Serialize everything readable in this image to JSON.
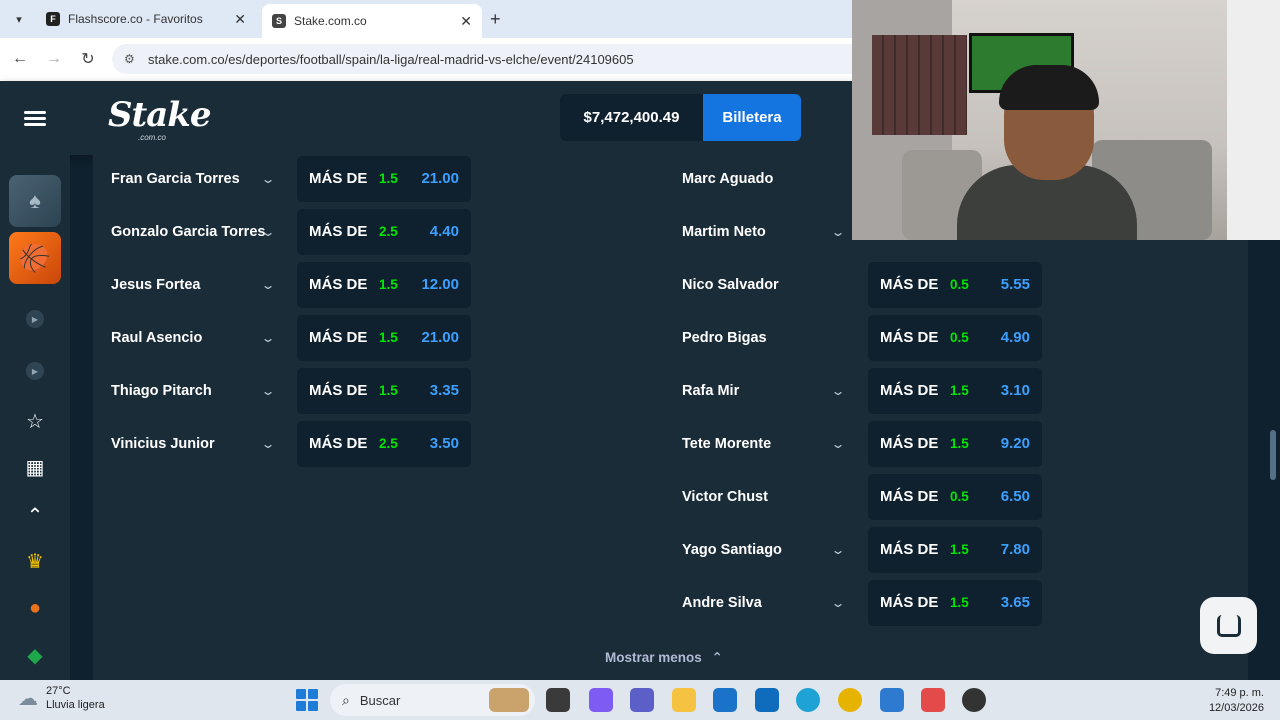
{
  "browser": {
    "tabs": [
      {
        "title": "Flashscore.co - Favoritos"
      },
      {
        "title": "Stake.com.co"
      }
    ],
    "url": "stake.com.co/es/deportes/football/spain/la-liga/real-madrid-vs-elche/event/24109605"
  },
  "header": {
    "logo": "Stake",
    "logo_sub": ".com.co",
    "balance": "$7,472,400.49",
    "wallet_label": "Billetera"
  },
  "left_column": [
    {
      "player": "Fran Garcia Torres",
      "label": "MÁS DE",
      "line": "1.5",
      "price": "21.00"
    },
    {
      "player": "Gonzalo Garcia Torres",
      "label": "MÁS DE",
      "line": "2.5",
      "price": "4.40"
    },
    {
      "player": "Jesus Fortea",
      "label": "MÁS DE",
      "line": "1.5",
      "price": "12.00"
    },
    {
      "player": "Raul Asencio",
      "label": "MÁS DE",
      "line": "1.5",
      "price": "21.00"
    },
    {
      "player": "Thiago Pitarch",
      "label": "MÁS DE",
      "line": "1.5",
      "price": "3.35"
    },
    {
      "player": "Vinicius Junior",
      "label": "MÁS DE",
      "line": "2.5",
      "price": "3.50"
    }
  ],
  "right_column": [
    {
      "player": "Marc Aguado"
    },
    {
      "player": "Martim Neto"
    },
    {
      "player": "Nico Salvador",
      "label": "MÁS DE",
      "line": "0.5",
      "price": "5.55"
    },
    {
      "player": "Pedro Bigas",
      "label": "MÁS DE",
      "line": "0.5",
      "price": "4.90"
    },
    {
      "player": "Rafa Mir",
      "label": "MÁS DE",
      "line": "1.5",
      "price": "3.10"
    },
    {
      "player": "Tete Morente",
      "label": "MÁS DE",
      "line": "1.5",
      "price": "9.20"
    },
    {
      "player": "Victor Chust",
      "label": "MÁS DE",
      "line": "0.5",
      "price": "6.50"
    },
    {
      "player": "Yago Santiago",
      "label": "MÁS DE",
      "line": "1.5",
      "price": "7.80"
    },
    {
      "player": "Andre Silva",
      "label": "MÁS DE",
      "line": "1.5",
      "price": "3.65"
    }
  ],
  "show_less": "Mostrar menos",
  "taskbar": {
    "temperature": "27°C",
    "weather": "Lluvia ligera",
    "search_placeholder": "Buscar",
    "time": "7:49 p. m.",
    "date": "12/03/2026"
  },
  "colors": {
    "background": "#0f212e",
    "panel": "#1a2c38",
    "accent_blue": "#1475e1",
    "line_green": "#00e701"
  }
}
